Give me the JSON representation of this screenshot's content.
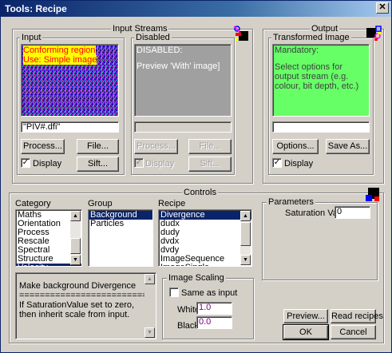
{
  "window": {
    "title": "Tools: Recipe",
    "close_glyph": "✕"
  },
  "input_streams": {
    "title": "Input Streams",
    "input": {
      "title": "Input",
      "preview_lines": [
        "Conforming region",
        "Use: Simple image"
      ],
      "filename": "\"PIV#.dfi\"",
      "process_label": "Process...",
      "file_label": "File...",
      "display_label": "Display",
      "display_checked": true,
      "sift_label": "Sift..."
    },
    "disabled": {
      "title": "Disabled",
      "preview_line1": "DISABLED:",
      "preview_line2": "Preview 'With' image]",
      "filename": "",
      "process_label": "Process...",
      "file_label": "File...",
      "display_label": "Display",
      "display_checked": true,
      "sift_label": "Sift..."
    }
  },
  "output": {
    "title": "Output",
    "transformed": {
      "title": "Transformed Image",
      "preview_line1": "Mandatory:",
      "preview_line2": "Select options for output stream (e.g. colour, bit depth, etc.)",
      "filename": "",
      "options_label": "Options...",
      "save_as_label": "Save As...",
      "display_label": "Display",
      "display_checked": true
    }
  },
  "controls": {
    "title": "Controls",
    "category": {
      "header": "Category",
      "items": [
        "Maths",
        "Orientation",
        "Process",
        "Rescale",
        "Spectral",
        "Structure",
        "Velocity"
      ],
      "selected_index": 6
    },
    "group": {
      "header": "Group",
      "items": [
        "Background",
        "Particles"
      ],
      "selected_index": 0
    },
    "recipe": {
      "header": "Recipe",
      "items": [
        "Divergence",
        "dudx",
        "dudy",
        "dvdx",
        "dvdy",
        "ImageSequence",
        "ImageSingle"
      ],
      "selected_index": 0
    },
    "parameters": {
      "title": "Parameters",
      "saturation_label": "Saturation Value",
      "saturation_value": "0"
    },
    "description": {
      "line1": "Make background Divergence",
      "line2": "================================",
      "line3": "If SaturationValue set to zero, then inherit scale from input."
    },
    "image_scaling": {
      "title": "Image Scaling",
      "same_as_input_label": "Same as input",
      "same_as_input_checked": false,
      "white_label": "White",
      "white_value": "1.0",
      "black_label": "Black",
      "black_value": "0.0"
    },
    "buttons": {
      "preview": "Preview...",
      "read_recipes": "Read recipes",
      "ok": "OK",
      "cancel": "Cancel"
    }
  },
  "colors": {
    "title_bar": "#0a246a",
    "face": "#d4d0c8",
    "output_preview": "#66ff66",
    "disabled_preview": "#a0a0a0",
    "list_selection": "#0a246a",
    "value_text": "#800080"
  },
  "icons": [
    "stream-config-icon",
    "output-config-icon",
    "controls-config-icon"
  ]
}
